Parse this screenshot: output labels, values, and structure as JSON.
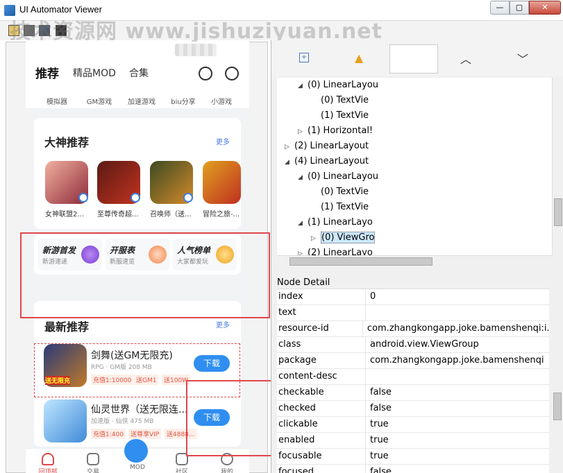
{
  "window": {
    "title": "UI Automator Viewer",
    "min_glyph": "—",
    "max_glyph": "▢",
    "close_glyph": "✕"
  },
  "watermark": "技术资源网 www.jishuziyuan.net",
  "phone": {
    "tabs": [
      "推荐",
      "精品MOD",
      "合集"
    ],
    "categories": [
      "模拟器",
      "GM游戏",
      "加速游戏",
      "biu分享",
      "小游戏"
    ],
    "gods": {
      "title": "大神推荐",
      "more": "更多",
      "games": [
        "女神联盟2...",
        "至尊传奇超...",
        "召唤师（送...",
        "冒险之旅-..."
      ]
    },
    "tri": [
      {
        "title": "新游首发",
        "sub": "新游速递"
      },
      {
        "title": "开服表",
        "sub": "新服速览"
      },
      {
        "title": "人气榜单",
        "sub": "大家都爱玩"
      }
    ],
    "latest": {
      "title": "最新推荐",
      "more": "更多",
      "apps": [
        {
          "name": "剑舞(送GM无限充)",
          "meta": "RPG · GM版  208 MB",
          "tags": [
            "充值1:10000",
            "送GM1",
            "送100W"
          ],
          "button": "下载",
          "icon_text": "送无限充"
        },
        {
          "name": "仙灵世界（送无限连...",
          "meta": "加速版 · 仙侠  475 MB",
          "tags": [
            "充值1:400",
            "送尊享VIP",
            "送4888..."
          ],
          "button": "下载"
        }
      ]
    },
    "nav": [
      "回顶部",
      "交易",
      "MOD",
      "社区",
      "我的"
    ]
  },
  "tree": [
    {
      "indent": 4,
      "arrow": "◢",
      "label": "(0) LinearLayou"
    },
    {
      "indent": 5,
      "arrow": "",
      "label": "(0) TextVie"
    },
    {
      "indent": 5,
      "arrow": "",
      "label": "(1) TextVie"
    },
    {
      "indent": 4,
      "arrow": "▷",
      "label": "(1) Horizontal!"
    },
    {
      "indent": 3,
      "arrow": "▷",
      "label": "(2) LinearLayout"
    },
    {
      "indent": 3,
      "arrow": "◢",
      "label": "(4) LinearLayout"
    },
    {
      "indent": 4,
      "arrow": "◢",
      "label": "(0) LinearLayou"
    },
    {
      "indent": 5,
      "arrow": "",
      "label": "(0) TextVie"
    },
    {
      "indent": 5,
      "arrow": "",
      "label": "(1) TextVie"
    },
    {
      "indent": 4,
      "arrow": "◢",
      "label": "(1) LinearLayo"
    },
    {
      "indent": 5,
      "arrow": "▷",
      "label": "(0) ViewGro",
      "selected": true
    },
    {
      "indent": 4,
      "arrow": "▷",
      "label": "(2) LinearLayo"
    }
  ],
  "node_detail": {
    "header": "Node Detail",
    "rows": [
      {
        "key": "index",
        "value": "0"
      },
      {
        "key": "text",
        "value": ""
      },
      {
        "key": "resource-id",
        "value": "com.zhangkongapp.joke.bamenshenqi:i..."
      },
      {
        "key": "class",
        "value": "android.view.ViewGroup"
      },
      {
        "key": "package",
        "value": "com.zhangkongapp.joke.bamenshenqi"
      },
      {
        "key": "content-desc",
        "value": ""
      },
      {
        "key": "checkable",
        "value": "false"
      },
      {
        "key": "checked",
        "value": "false"
      },
      {
        "key": "clickable",
        "value": "true"
      },
      {
        "key": "enabled",
        "value": "true"
      },
      {
        "key": "focusable",
        "value": "true"
      },
      {
        "key": "focused",
        "value": "false"
      }
    ]
  },
  "colors": {
    "accent": "#2f8ef0",
    "highlight": "#e0474b",
    "selected_row": "#cde8ff"
  }
}
